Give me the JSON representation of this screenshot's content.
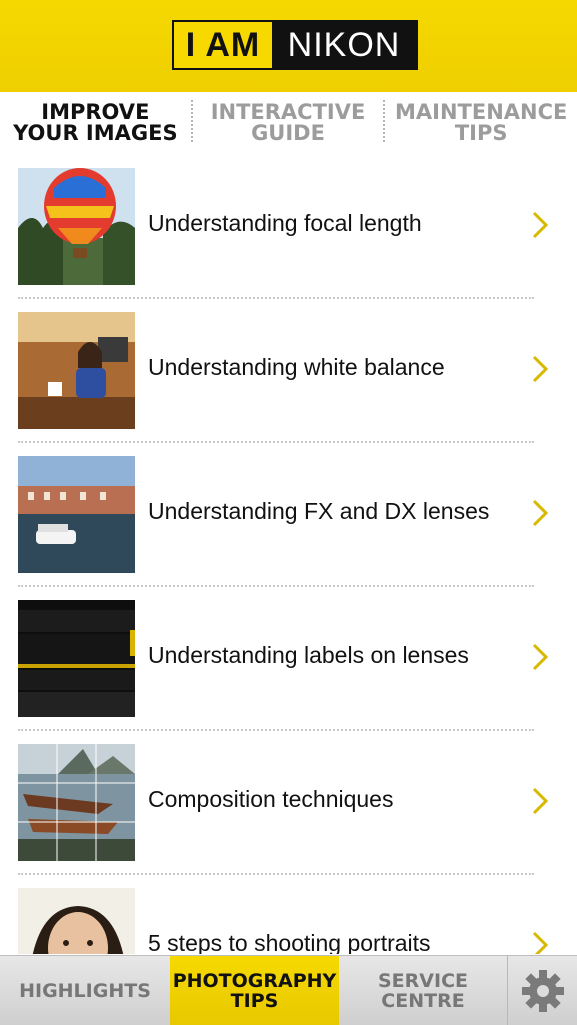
{
  "header": {
    "logo_left": "I AM",
    "logo_right": "NIKON"
  },
  "tabs": [
    {
      "label": "IMPROVE\nYOUR IMAGES",
      "active": true
    },
    {
      "label": "INTERACTIVE\nGUIDE",
      "active": false
    },
    {
      "label": "MAINTENANCE\nTIPS",
      "active": false
    }
  ],
  "items": [
    {
      "title": "Understanding focal length",
      "thumb_icon": "hot-air-balloon-photo"
    },
    {
      "title": "Understanding white balance",
      "thumb_icon": "woman-at-table-photo"
    },
    {
      "title": "Understanding FX and DX lenses",
      "thumb_icon": "canal-boat-photo"
    },
    {
      "title": "Understanding labels on lenses",
      "thumb_icon": "nikon-lens-photo"
    },
    {
      "title": "Composition techniques",
      "thumb_icon": "boats-grid-photo"
    },
    {
      "title": "5 steps to shooting portraits",
      "thumb_icon": "portrait-photo"
    }
  ],
  "bottom_nav": {
    "highlights": "HIGHLIGHTS",
    "photography_tips": "PHOTOGRAPHY\nTIPS",
    "service_centre": "SERVICE\nCENTRE",
    "settings_icon": "gear-icon"
  },
  "colors": {
    "brand_yellow": "#f5d800",
    "chevron": "#d9b800",
    "inactive_text": "#9c9c9c"
  }
}
